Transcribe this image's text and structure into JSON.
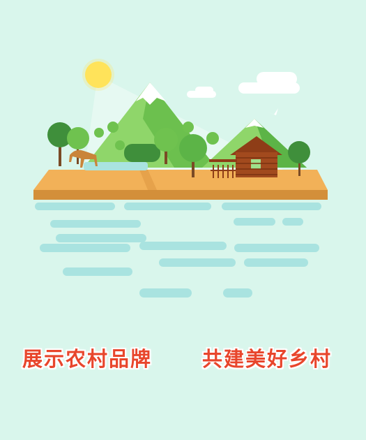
{
  "slogans": {
    "left": "展示农村品牌",
    "right": "共建美好乡村"
  },
  "colors": {
    "background": "#d9f6ec",
    "slogan_text": "#e8462c",
    "slogan_outline": "#ffffff",
    "water": "#a9e3e0",
    "island_top": "#f2b158",
    "island_side": "#d38f3a",
    "mountain_light": "#8fd66a",
    "mountain_dark": "#5cb447",
    "tree_dark": "#3f8f3b",
    "tree_light": "#6fc24f",
    "cabin": "#a24a1e",
    "sun": "#ffe35a"
  },
  "icons": [
    "sun-icon",
    "cloud-icon",
    "bird-icon",
    "deer-icon",
    "cabin-icon",
    "tree-icon"
  ]
}
